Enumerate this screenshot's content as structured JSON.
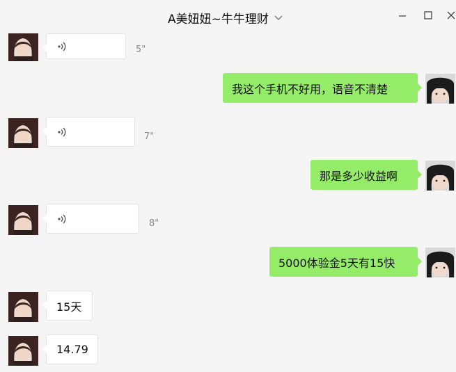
{
  "window": {
    "title": "A美妞妞~牛牛理财"
  },
  "colors": {
    "background": "#f5f5f5",
    "incoming_bubble": "#ffffff",
    "outgoing_bubble": "#95ec69",
    "duration_text": "#8a8a8a"
  },
  "messages": [
    {
      "direction": "incoming",
      "type": "voice",
      "duration": "5\""
    },
    {
      "direction": "outgoing",
      "type": "text",
      "text": "我这个手机不好用，语音不清楚"
    },
    {
      "direction": "incoming",
      "type": "voice",
      "duration": "7\""
    },
    {
      "direction": "outgoing",
      "type": "text",
      "text": "那是多少收益啊"
    },
    {
      "direction": "incoming",
      "type": "voice",
      "duration": "8\""
    },
    {
      "direction": "outgoing",
      "type": "text",
      "text": "5000体验金5天有15快"
    },
    {
      "direction": "incoming",
      "type": "text",
      "text": "15天"
    },
    {
      "direction": "incoming",
      "type": "text",
      "text": "14.79"
    }
  ]
}
